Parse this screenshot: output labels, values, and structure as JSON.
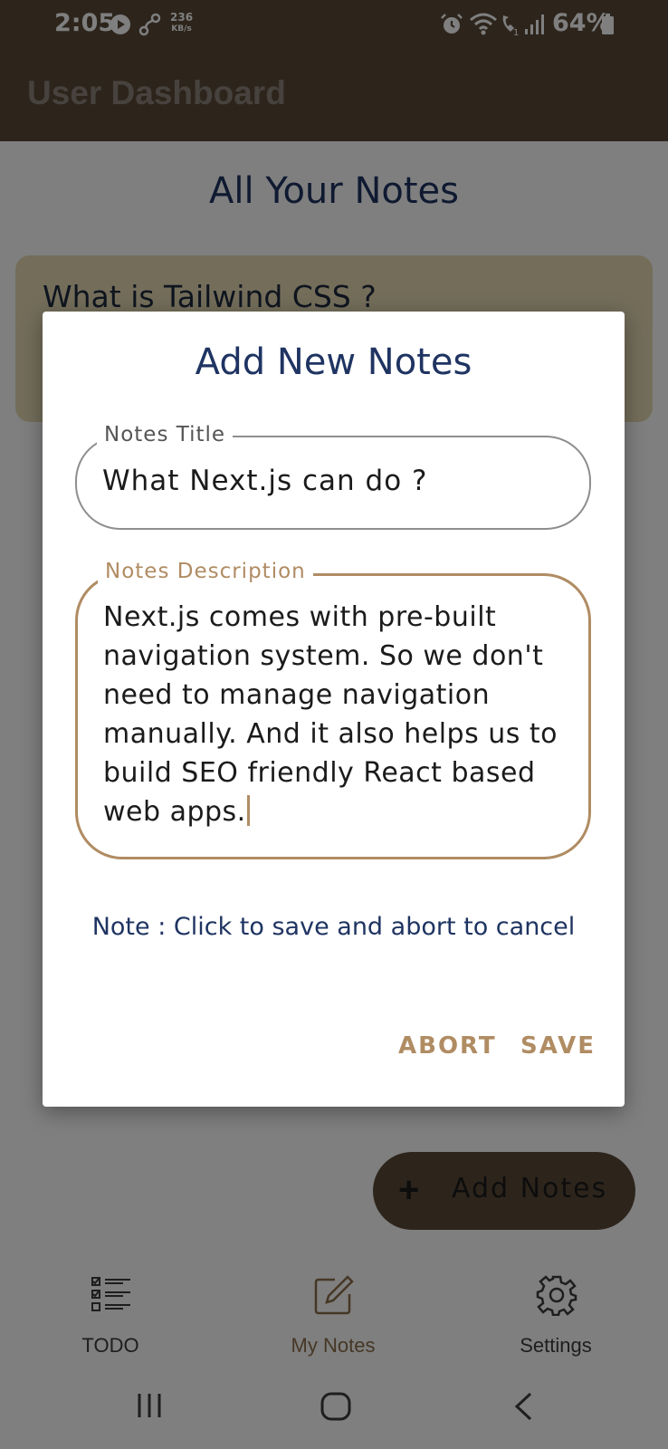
{
  "status_bar": {
    "time": "2:05",
    "speed_value": "236",
    "speed_unit": "KB/s",
    "battery": "64%",
    "icons": [
      "play-icon",
      "share-icon",
      "alarm-icon",
      "wifi-icon",
      "wifi-call-icon",
      "signal-icon",
      "battery-icon"
    ]
  },
  "app_bar": {
    "title": "User Dashboard"
  },
  "page": {
    "title": "All Your Notes",
    "notes": [
      {
        "title": "What is Tailwind CSS ?"
      }
    ]
  },
  "dialog": {
    "title": "Add New Notes",
    "title_field": {
      "label": "Notes Title",
      "value": "What Next.js can do ?"
    },
    "description_field": {
      "label": "Notes Description",
      "value": "Next.js comes with pre-built navigation system. So we don't need to manage navigation manually. And it also helps us to build SEO friendly React based web apps."
    },
    "note": "Note : Click to save and abort to cancel",
    "abort_label": "ABORT",
    "save_label": "SAVE"
  },
  "fab": {
    "label": "Add Notes",
    "icon": "plus-icon"
  },
  "bottom_nav": {
    "items": [
      {
        "label": "TODO",
        "icon": "checklist-icon"
      },
      {
        "label": "My Notes",
        "icon": "edit-note-icon",
        "active": true
      },
      {
        "label": "Settings",
        "icon": "gear-icon"
      }
    ]
  },
  "system_nav": {
    "icons": [
      "recents-icon",
      "home-icon",
      "back-icon"
    ]
  },
  "colors": {
    "app_bar": "#5b4a39",
    "accent": "#b08c63",
    "title_text": "#1f3462",
    "note_card": "#e7dbb4"
  }
}
